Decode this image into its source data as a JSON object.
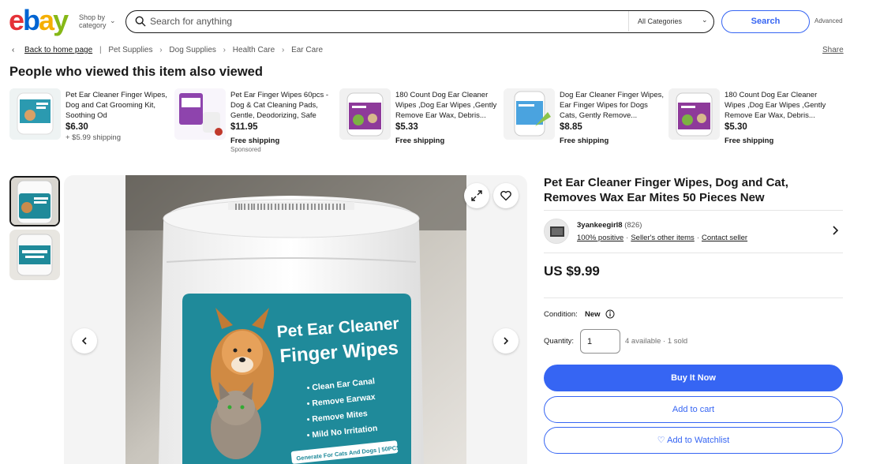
{
  "header": {
    "logo": [
      "e",
      "b",
      "a",
      "y"
    ],
    "logo_colors": [
      "#e53238",
      "#0064d2",
      "#f5af02",
      "#86b817"
    ],
    "shop_by_line1": "Shop by",
    "shop_by_line2": "category",
    "search_placeholder": "Search for anything",
    "category_select": "All Categories",
    "search_button": "Search",
    "advanced": "Advanced"
  },
  "breadcrumb": {
    "items": [
      "Back to home page",
      "Pet Supplies",
      "Dog Supplies",
      "Health Care",
      "Ear Care"
    ],
    "share": "Share"
  },
  "recommendations": {
    "title": "People who viewed this item also viewed",
    "items": [
      {
        "title": "Pet Ear Cleaner Finger Wipes, Dog and Cat Grooming Kit, Soothing Od",
        "price": "$6.30",
        "shipping": "+ $5.99 shipping",
        "sponsored": ""
      },
      {
        "title": "Pet Ear Finger Wipes 60pcs - Dog & Cat Cleaning Pads, Gentle, Deodorizing, Safe",
        "price": "$11.95",
        "shipping": "Free shipping",
        "sponsored": "Sponsored"
      },
      {
        "title": "180 Count Dog Ear Cleaner Wipes ,Dog Ear Wipes ,Gently Remove Ear Wax, Debris...",
        "price": "$5.33",
        "shipping": "Free shipping",
        "sponsored": ""
      },
      {
        "title": "Dog Ear Cleaner Finger Wipes, Ear Finger Wipes for Dogs Cats, Gently Remove...",
        "price": "$8.85",
        "shipping": "Free shipping",
        "sponsored": ""
      },
      {
        "title": "180 Count Dog Ear Cleaner Wipes ,Dog Ear Wipes ,Gently Remove Ear Wax, Debris...",
        "price": "$5.30",
        "shipping": "Free shipping",
        "sponsored": ""
      }
    ]
  },
  "product_image": {
    "label_line1": "Pet Ear Cleaner",
    "label_line2": "Finger Wipes",
    "bullets": [
      "Clean Ear Canal",
      "Remove Earwax",
      "Remove Mites",
      "Mild No Irritation"
    ],
    "footer": "Generate For Cats And Dogs",
    "count": "50PCS"
  },
  "item": {
    "title": "Pet Ear Cleaner Finger Wipes, Dog and Cat, Removes Wax Ear Mites 50 Pieces New",
    "seller": {
      "name": "3yankeegirl8",
      "score": "(826)",
      "positive": "100% positive",
      "other_items": "Seller's other items",
      "contact": "Contact seller"
    },
    "price": "US $9.99",
    "condition_label": "Condition:",
    "condition_value": "New",
    "quantity_label": "Quantity:",
    "quantity_value": "1",
    "availability": "4 available · 1 sold",
    "buy_now": "Buy It Now",
    "add_to_cart": "Add to cart",
    "watchlist": "♡ Add to Watchlist"
  },
  "colors": {
    "accent": "#3665f3",
    "teal_label": "#1f8a9a"
  }
}
